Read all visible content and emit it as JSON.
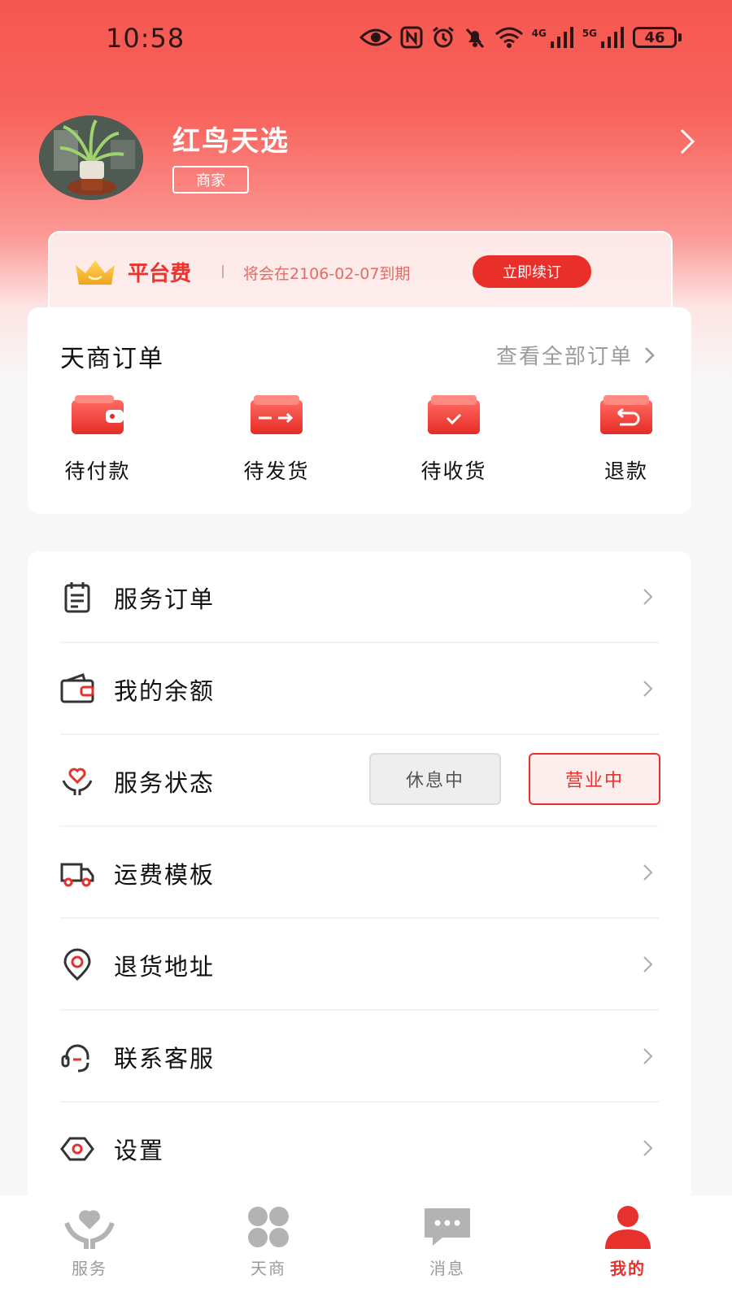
{
  "status_bar": {
    "time": "10:58",
    "net1": "4G",
    "net2": "5G",
    "battery": "46"
  },
  "profile": {
    "name": "红鸟天选",
    "role": "商家"
  },
  "platform_fee": {
    "label": "平台费",
    "expire_text": "将会在2106-02-07到期",
    "renew_label": "立即续订"
  },
  "orders": {
    "title": "天商订单",
    "view_all": "查看全部订单",
    "items": [
      {
        "label": "待付款",
        "icon": "wallet-icon"
      },
      {
        "label": "待发货",
        "icon": "shipping-box-icon"
      },
      {
        "label": "待收货",
        "icon": "received-box-icon"
      },
      {
        "label": "退款",
        "icon": "refund-box-icon"
      }
    ]
  },
  "menu": {
    "items": [
      {
        "label": "服务订单",
        "icon": "clipboard-icon"
      },
      {
        "label": "我的余额",
        "icon": "wallet-outline-icon"
      },
      {
        "label": "服务状态",
        "icon": "heart-hand-icon",
        "rest_label": "休息中",
        "open_label": "营业中",
        "selected": "营业中"
      },
      {
        "label": "运费模板",
        "icon": "truck-icon"
      },
      {
        "label": "退货地址",
        "icon": "location-pin-icon"
      },
      {
        "label": "联系客服",
        "icon": "headset-icon"
      },
      {
        "label": "设置",
        "icon": "settings-hexagon-icon"
      }
    ]
  },
  "tabs": [
    {
      "label": "服务",
      "icon": "heart-hand-icon",
      "active": false
    },
    {
      "label": "天商",
      "icon": "clover-icon",
      "active": false
    },
    {
      "label": "消息",
      "icon": "chat-bubble-icon",
      "active": false
    },
    {
      "label": "我的",
      "icon": "person-icon",
      "active": true
    }
  ],
  "colors": {
    "accent": "#e6312c",
    "hero_top": "#f5574f",
    "inactive_tab": "#9a9a9a",
    "background": "#f7f7f7"
  }
}
